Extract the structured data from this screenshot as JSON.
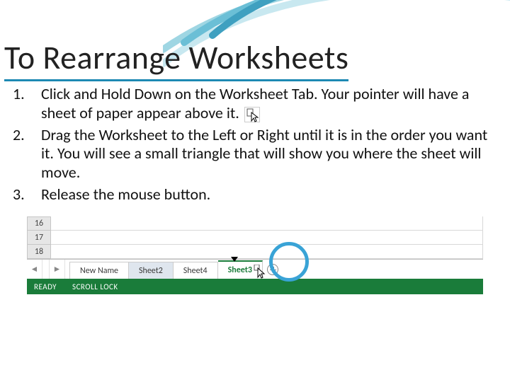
{
  "title": "To Rearrange Worksheets",
  "steps": [
    {
      "pre": "Click and Hold Down on the Worksheet Tab. Your pointer will have a sheet of paper appear above it.",
      "icon_after_word": "Tab."
    },
    {
      "pre": "Drag the Worksheet to the Left or Right until it is in the order you want it. You will see a small triangle that will show you where the sheet will move."
    },
    {
      "pre": "Release the mouse button."
    }
  ],
  "excel": {
    "row_headers": [
      "16",
      "17",
      "18"
    ],
    "nav_left": "◄",
    "nav_right": "►",
    "tabs": [
      {
        "label": "New Name",
        "state": "first"
      },
      {
        "label": "Sheet2",
        "state": "hover"
      },
      {
        "label": "Sheet4",
        "state": ""
      },
      {
        "label": "Sheet3",
        "state": "active"
      }
    ],
    "status": {
      "ready": "READY",
      "scroll_lock": "SCROLL LOCK"
    }
  }
}
